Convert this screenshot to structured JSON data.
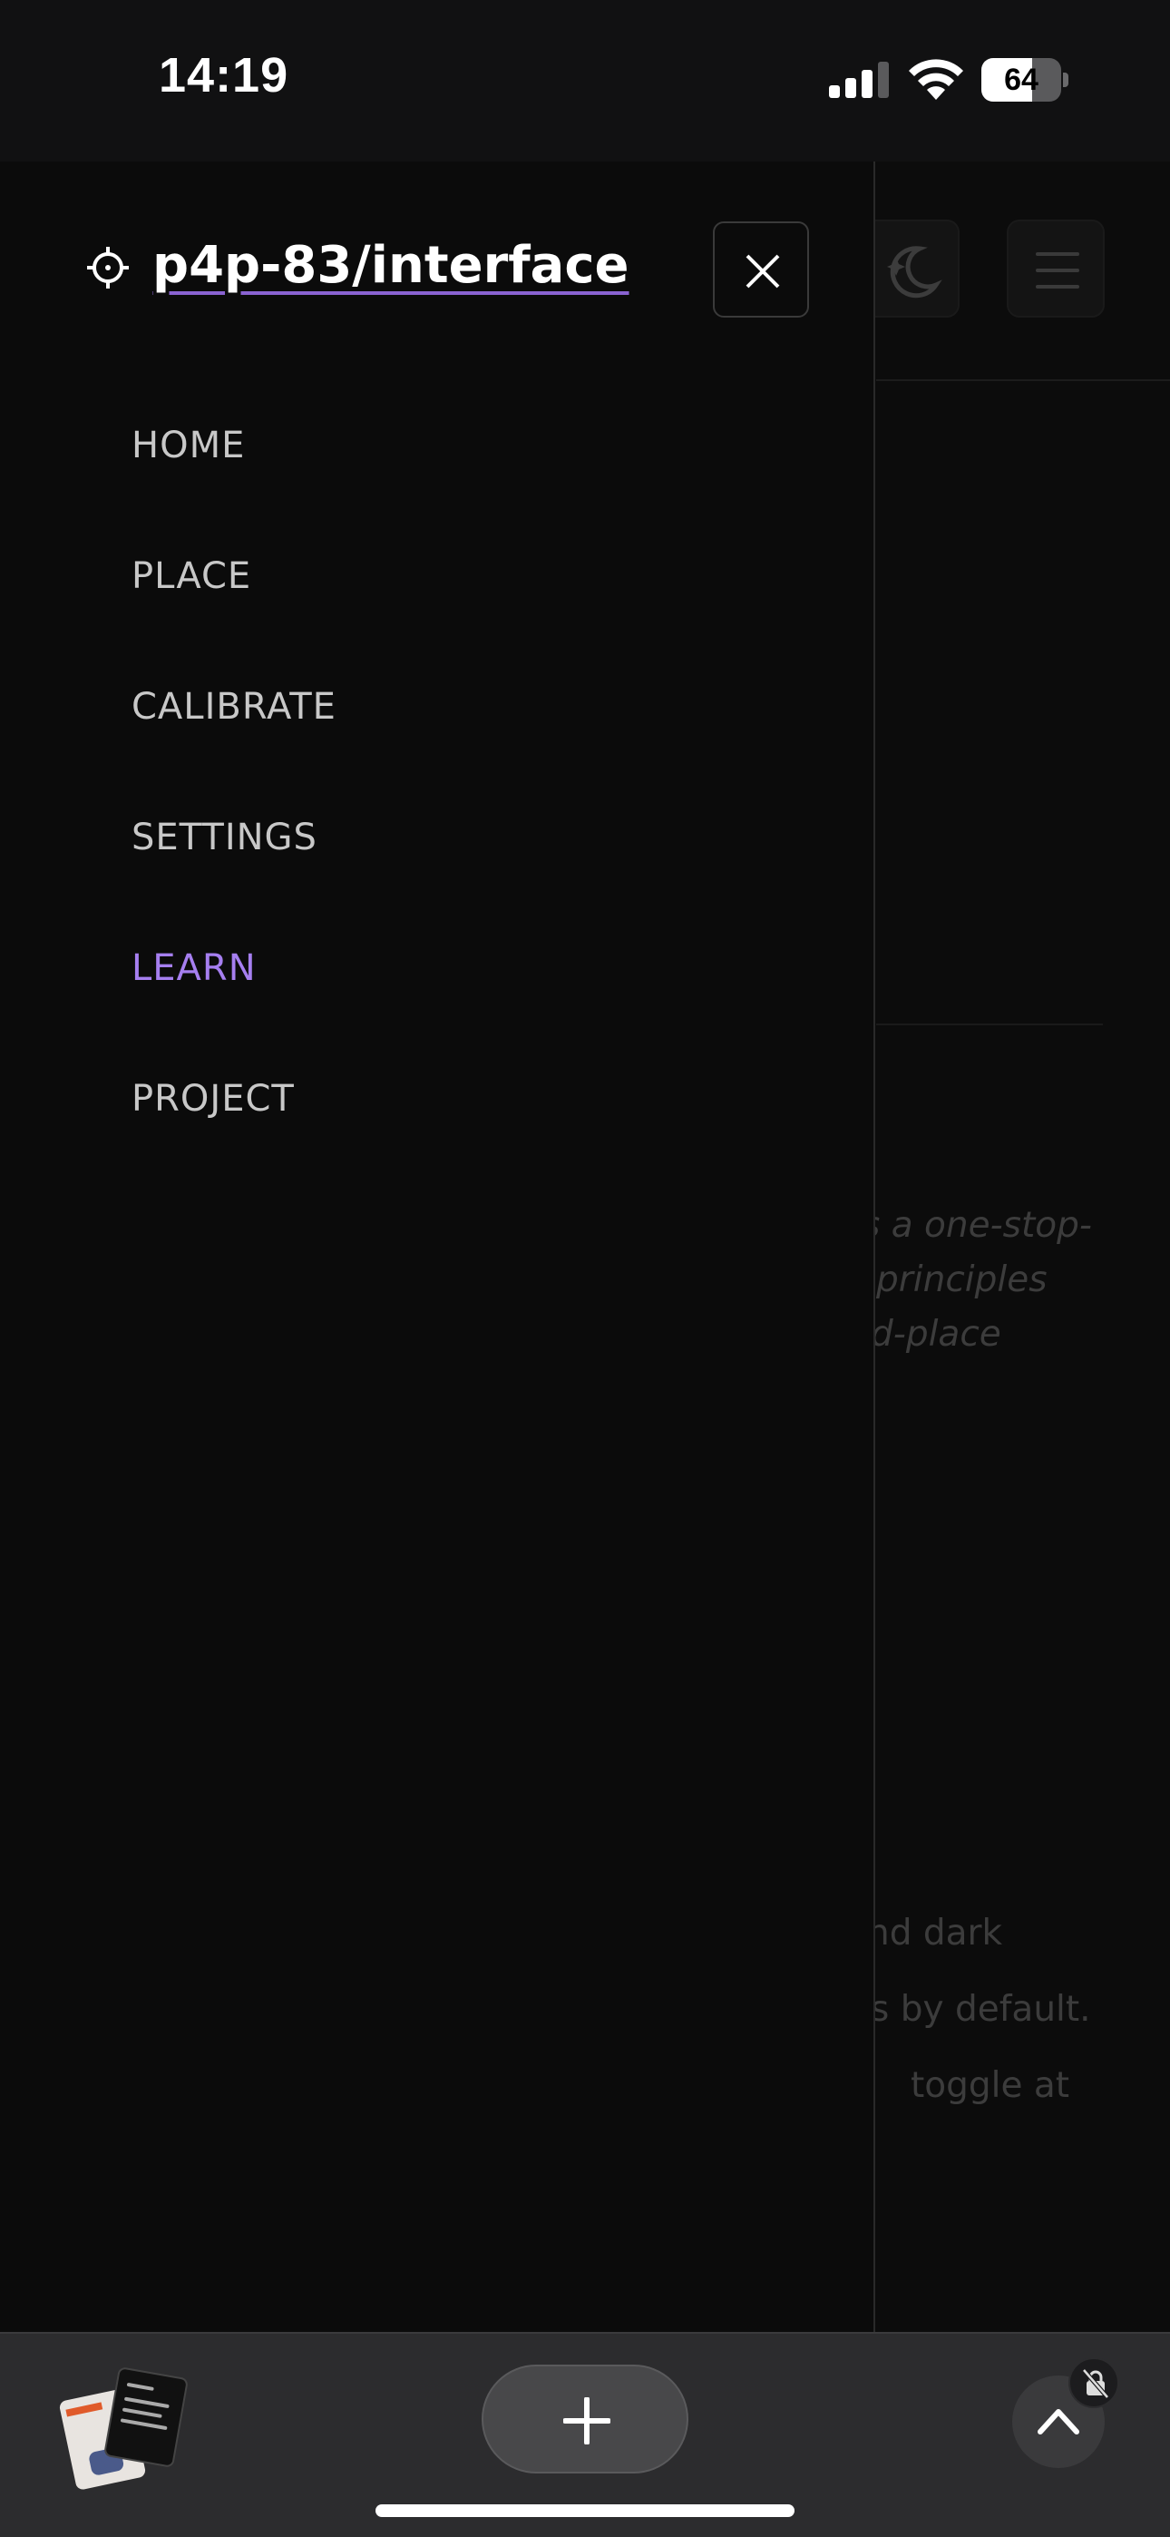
{
  "status_bar": {
    "time": "14:19",
    "battery_percent": "64",
    "battery_level": 0.64,
    "signal_icon": "cellular-signal-icon",
    "wifi_icon": "wifi-icon"
  },
  "drawer": {
    "brand": "p4p-83/interface",
    "brand_icon": "crosshair-icon",
    "close_icon": "close-icon",
    "nav_items": [
      {
        "label": "HOME",
        "active": false
      },
      {
        "label": "PLACE",
        "active": false
      },
      {
        "label": "CALIBRATE",
        "active": false
      },
      {
        "label": "SETTINGS",
        "active": false
      },
      {
        "label": "LEARN",
        "active": true
      },
      {
        "label": "PROJECT",
        "active": false
      }
    ],
    "active_color": "#a67ff0"
  },
  "background_page": {
    "theme_icon": "moon-stars-icon",
    "menu_icon": "hamburger-menu-icon",
    "intro_lines": [
      "s a one-stop-",
      "principles",
      "d-place"
    ],
    "body_lines": [
      "nd dark",
      "s by default.",
      "toggle at"
    ]
  },
  "bottom_bar": {
    "tabs_icon": "tab-thumbnails-icon",
    "new_tab_icon": "plus-icon",
    "scroll_up_icon": "chevron-up-icon",
    "privacy_icon": "lock-slash-icon"
  }
}
